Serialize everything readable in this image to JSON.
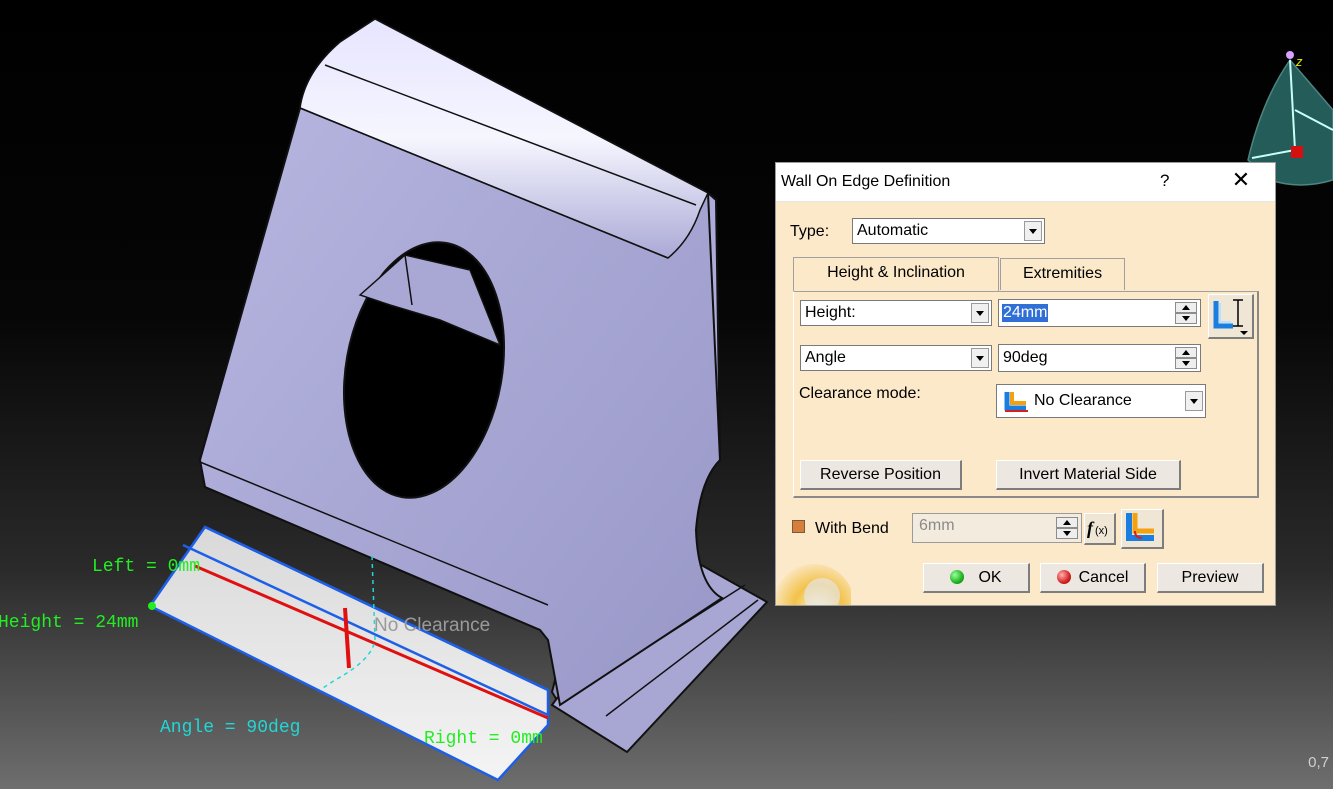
{
  "viewport": {
    "annotations": {
      "left": "Left = 0mm",
      "height": "Height = 24mm",
      "angle": "Angle = 90deg",
      "right": "Right = 0mm",
      "clearance": "No Clearance"
    },
    "compass_axis": "z",
    "scale_readout": "0,7"
  },
  "dialog": {
    "title": "Wall On Edge Definition",
    "help": "?",
    "close": "✕",
    "type_label": "Type:",
    "type_value": "Automatic",
    "tabs": [
      {
        "label": "Height & Inclination",
        "active": true
      },
      {
        "label": "Extremities",
        "active": false
      }
    ],
    "height_mode": "Height:",
    "height_value": "24mm",
    "angle_mode": "Angle",
    "angle_value": "90deg",
    "clearance_label": "Clearance mode:",
    "clearance_value": "No Clearance",
    "reverse_position": "Reverse Position",
    "invert_material": "Invert Material Side",
    "with_bend_label": "With Bend",
    "with_bend_checked": true,
    "bend_value": "6mm",
    "ok": "OK",
    "cancel": "Cancel",
    "preview": "Preview",
    "icons": [
      "height-reference-icon",
      "no-clearance-icon",
      "formula-icon",
      "bend-parameters-icon",
      "ok-icon",
      "cancel-icon"
    ]
  },
  "colors": {
    "dialog_bg": "#fbe9c9",
    "part_face": "#a9a8d4",
    "annotation_green": "#22ee22",
    "annotation_cyan": "#22d6d6",
    "selection_blue": "#1e5fe8",
    "edge_red": "#e01010",
    "ok_green": "#1fb21f",
    "cancel_red": "#d62020"
  }
}
